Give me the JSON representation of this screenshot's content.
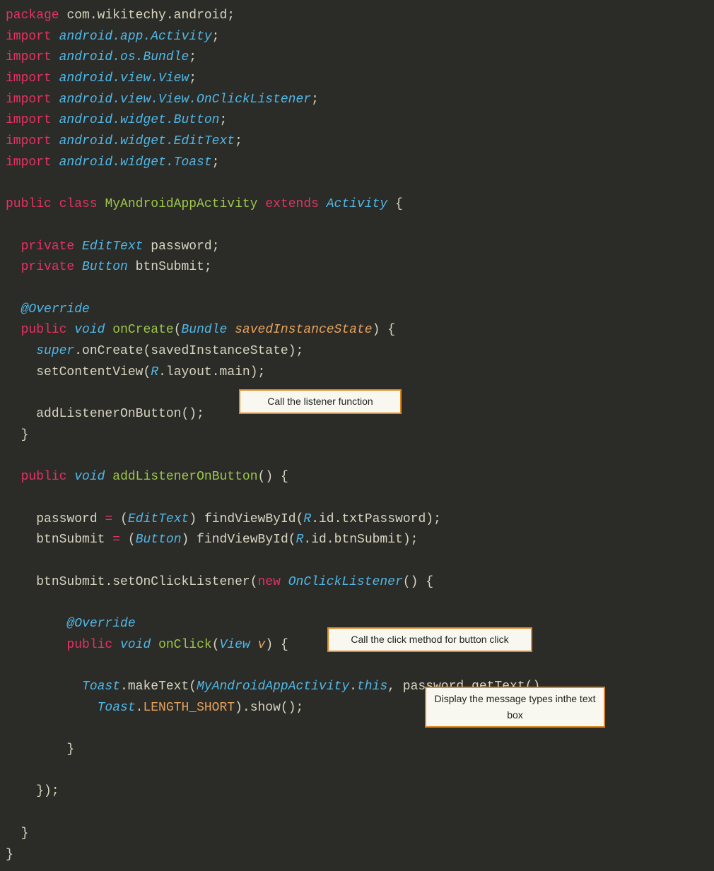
{
  "code": {
    "l1": {
      "package_kw": "package",
      "pkg": "com.wikitechy.android",
      "semi": ";"
    },
    "imports": [
      {
        "import_kw": "import",
        "path": "android.app.Activity",
        "semi": ";"
      },
      {
        "import_kw": "import",
        "path": "android.os.Bundle",
        "semi": ";"
      },
      {
        "import_kw": "import",
        "path": "android.view.View",
        "semi": ";"
      },
      {
        "import_kw": "import",
        "path": "android.view.View.OnClickListener",
        "semi": ";"
      },
      {
        "import_kw": "import",
        "path": "android.widget.Button",
        "semi": ";"
      },
      {
        "import_kw": "import",
        "path": "android.widget.EditText",
        "semi": ";"
      },
      {
        "import_kw": "import",
        "path": "android.widget.Toast",
        "semi": ";"
      }
    ],
    "classdecl": {
      "public_kw": "public",
      "class_kw": "class",
      "name": "MyAndroidAppActivity",
      "extends_kw": "extends",
      "parent": "Activity",
      "open": "{"
    },
    "field1": {
      "private_kw": "private",
      "type": "EditText",
      "name": "password",
      "semi": ";"
    },
    "field2": {
      "private_kw": "private",
      "type": "Button",
      "name": "btnSubmit",
      "semi": ";"
    },
    "override1": "@Override",
    "onCreateSig": {
      "public_kw": "public",
      "void_kw": "void",
      "name": "onCreate",
      "op": "(",
      "ptype": "Bundle",
      "pname": "savedInstanceState",
      "cp": ")",
      "ob": "{"
    },
    "superCall": {
      "super_kw": "super",
      "dot": ".",
      "method": "onCreate",
      "op": "(",
      "arg": "savedInstanceState",
      "cp": ")",
      "semi": ";"
    },
    "setContent": {
      "method": "setContentView",
      "op": "(",
      "R": "R",
      "dot1": ".",
      "layout": "layout",
      "dot2": ".",
      "main": "main",
      "cp": ")",
      "semi": ";"
    },
    "addListenerCall": {
      "method": "addListenerOnButton",
      "op": "(",
      "cp": ")",
      "semi": ";"
    },
    "close_onCreate": "}",
    "addListenerSig": {
      "public_kw": "public",
      "void_kw": "void",
      "name": "addListenerOnButton",
      "op": "(",
      "cp": ")",
      "ob": "{"
    },
    "assign1": {
      "lhs": "password",
      "eq": "=",
      "op": "(",
      "cast": "EditText",
      "cp": ")",
      "method": "findViewById",
      "op2": "(",
      "R": "R",
      "d1": ".",
      "id": "id",
      "d2": ".",
      "ref": "txtPassword",
      "cp2": ")",
      "semi": ";"
    },
    "assign2": {
      "lhs": "btnSubmit",
      "eq": "=",
      "op": "(",
      "cast": "Button",
      "cp": ")",
      "method": "findViewById",
      "op2": "(",
      "R": "R",
      "d1": ".",
      "id": "id",
      "d2": ".",
      "ref": "btnSubmit",
      "cp2": ")",
      "semi": ";"
    },
    "setListener": {
      "obj": "btnSubmit",
      "dot": ".",
      "method": "setOnClickListener",
      "op": "(",
      "new_kw": "new",
      "type": "OnClickListener",
      "op2": "(",
      "cp2": ")",
      "ob": "{"
    },
    "override2": "@Override",
    "onClickSig": {
      "public_kw": "public",
      "void_kw": "void",
      "name": "onClick",
      "op": "(",
      "ptype": "View",
      "pname": "v",
      "cp": ")",
      "ob": "{"
    },
    "toast": {
      "cls": "Toast",
      "d1": ".",
      "makeText": "makeText",
      "op": "(",
      "outer": "MyAndroidAppActivity",
      "d2": ".",
      "this_kw": "this",
      "comma": ",",
      "pwd": "password",
      "d3": ".",
      "getText": "getText",
      "op2": "(",
      "cp2": ")",
      "comma2": ",",
      "cls2": "Toast",
      "d4": ".",
      "const": "LENGTH_SHORT",
      "cp": ")",
      "d5": ".",
      "show": "show",
      "op3": "(",
      "cp3": ")",
      "semi": ";"
    },
    "close_onClick": "}",
    "close_anon": "});",
    "close_addListener": "}",
    "close_class": "}"
  },
  "annotations": {
    "a1": "Call the listener function",
    "a2": "Call the click method for button click",
    "a3": "Display the message types inthe text box"
  }
}
